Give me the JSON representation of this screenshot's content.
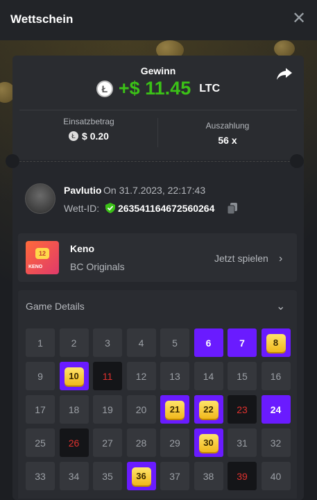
{
  "header": {
    "title": "Wettschein"
  },
  "win": {
    "label": "Gewinn",
    "amount": "+$ 11.45",
    "currency": "LTC",
    "coin_icon": "ltc-coin-icon"
  },
  "stats": {
    "stake_label": "Einsatzbetrag",
    "stake_value": "$ 0.20",
    "payout_label": "Auszahlung",
    "payout_value": "56 x"
  },
  "bet": {
    "username": "Pavlutio",
    "date": "On 31.7.2023, 22:17:43",
    "id_label": "Wett-ID:",
    "id": "263541164672560264"
  },
  "game": {
    "name": "Keno",
    "provider": "BC Originals",
    "play_label": "Jetzt spielen",
    "thumb_number": "12",
    "thumb_word": "KENO"
  },
  "details": {
    "title": "Game Details"
  },
  "colors": {
    "accent_green": "#3bc117",
    "pick_purple": "#6a1bff",
    "drawn_red": "#e0312e",
    "gem_yellow": "#f0b81c"
  },
  "keno": {
    "cells": [
      {
        "n": "1",
        "s": "normal"
      },
      {
        "n": "2",
        "s": "normal"
      },
      {
        "n": "3",
        "s": "normal"
      },
      {
        "n": "4",
        "s": "normal"
      },
      {
        "n": "5",
        "s": "normal"
      },
      {
        "n": "6",
        "s": "pick"
      },
      {
        "n": "7",
        "s": "pick"
      },
      {
        "n": "8",
        "s": "hit"
      },
      {
        "n": "9",
        "s": "normal"
      },
      {
        "n": "10",
        "s": "hit"
      },
      {
        "n": "11",
        "s": "drawn"
      },
      {
        "n": "12",
        "s": "normal"
      },
      {
        "n": "13",
        "s": "normal"
      },
      {
        "n": "14",
        "s": "normal"
      },
      {
        "n": "15",
        "s": "normal"
      },
      {
        "n": "16",
        "s": "normal"
      },
      {
        "n": "17",
        "s": "normal"
      },
      {
        "n": "18",
        "s": "normal"
      },
      {
        "n": "19",
        "s": "normal"
      },
      {
        "n": "20",
        "s": "normal"
      },
      {
        "n": "21",
        "s": "hit"
      },
      {
        "n": "22",
        "s": "hit"
      },
      {
        "n": "23",
        "s": "drawn"
      },
      {
        "n": "24",
        "s": "pick"
      },
      {
        "n": "25",
        "s": "normal"
      },
      {
        "n": "26",
        "s": "drawn"
      },
      {
        "n": "27",
        "s": "normal"
      },
      {
        "n": "28",
        "s": "normal"
      },
      {
        "n": "29",
        "s": "normal"
      },
      {
        "n": "30",
        "s": "hit"
      },
      {
        "n": "31",
        "s": "normal"
      },
      {
        "n": "32",
        "s": "normal"
      },
      {
        "n": "33",
        "s": "normal"
      },
      {
        "n": "34",
        "s": "normal"
      },
      {
        "n": "35",
        "s": "normal"
      },
      {
        "n": "36",
        "s": "hit"
      },
      {
        "n": "37",
        "s": "normal"
      },
      {
        "n": "38",
        "s": "normal"
      },
      {
        "n": "39",
        "s": "drawn"
      },
      {
        "n": "40",
        "s": "normal"
      }
    ]
  }
}
